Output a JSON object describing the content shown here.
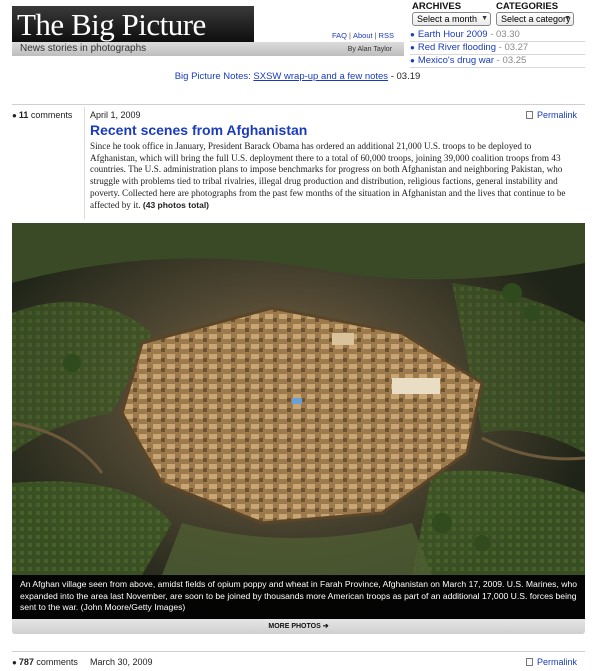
{
  "header": {
    "logo_text": "The Big Picture",
    "tagline": "News stories in photographs",
    "byline": "By Alan Taylor",
    "util_links": [
      "FAQ",
      "About",
      "RSS"
    ]
  },
  "sidebar": {
    "archives_label": "ARCHIVES",
    "archives_select": "Select a month",
    "categories_label": "CATEGORIES",
    "categories_select": "Select a category",
    "recent": [
      {
        "title": "Earth Hour 2009",
        "date": "- 03.30"
      },
      {
        "title": "Red River flooding",
        "date": "- 03.27"
      },
      {
        "title": "Mexico's drug war",
        "date": "- 03.25"
      }
    ]
  },
  "notes": {
    "label": "Big Picture Notes:",
    "link": "SXSW wrap-up and a few notes",
    "date": "- 03.19"
  },
  "post": {
    "comments_count": "11",
    "comments_word": "comments",
    "date": "April 1, 2009",
    "permalink": "Permalink",
    "title": "Recent scenes from Afghanistan",
    "body": "Since he took office in January, President Barack Obama has ordered an additional 21,000 U.S. troops to be deployed to Afghanistan, which will bring the full U.S. deployment there to a total of 60,000 troops, joining 39,000 coalition troops from 43 countries. The U.S. administration plans to impose benchmarks for progress on both Afghanistan and neighboring Pakistan, who struggle with problems tied to tribal rivalries, illegal drug production and distribution, religious factions, general instability and poverty. Collected here are photographs from the past few months of the situation in Afghanistan and the lives that continue to be affected by it.",
    "photo_count": "(43 photos total)",
    "caption": "An Afghan village seen from above, amidst fields of opium poppy and wheat in Farah Province, Afghanistan on March 17, 2009. U.S. Marines, who expanded into the area last November, are soon to be joined by thousands more American troops as part of an additional 17,000 U.S. forces being sent to the war. (John Moore/Getty Images)",
    "more_photos": "MORE PHOTOS",
    "more_arrow": "➔"
  },
  "next_post": {
    "comments_count": "787",
    "comments_word": "comments",
    "date": "March 30, 2009",
    "permalink": "Permalink"
  },
  "colors": {
    "link": "#1a3bbf",
    "caption_bg": "#000000",
    "field_green": "#3f5a24",
    "mud_wall": "#b08a5a"
  }
}
